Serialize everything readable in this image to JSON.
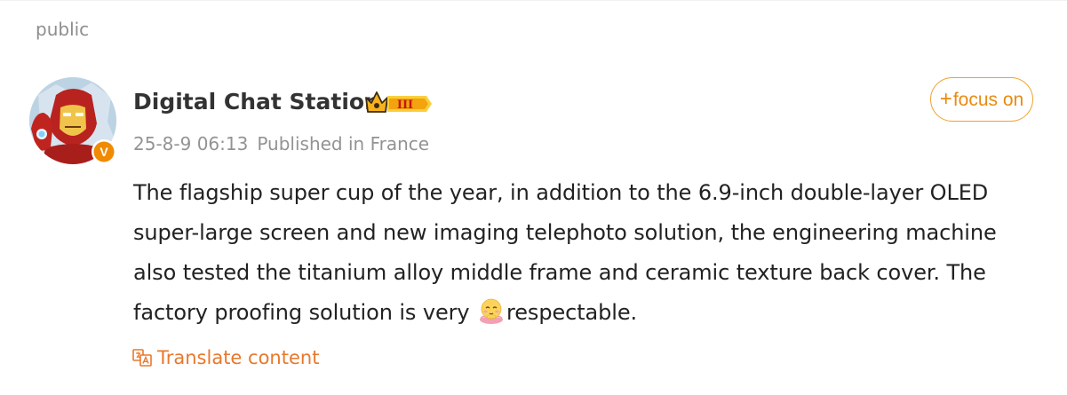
{
  "visibility": "public",
  "author": {
    "name": "Digital Chat Station",
    "rank_badge": "III",
    "verified_badge": "V"
  },
  "post": {
    "date": "25-8-9 06:13",
    "location": "Published in France",
    "text_lines": [
      "The flagship super cup of the year, in addition to the 6.9-inch double-layer OLED",
      "super-large screen and new imaging telephoto solution, the engineering machine",
      "also tested the titanium alloy middle frame and ceramic texture back cover. The",
      "factory proofing solution is very "
    ],
    "text_after_emoji": "respectable.",
    "inline_emoji": "respectful-face-emoji"
  },
  "follow_button": {
    "plus": "+",
    "label": "focus on"
  },
  "translate": {
    "label": "Translate content",
    "icon": "translate-icon"
  },
  "colors": {
    "accent_orange": "#e98b10",
    "translate_orange": "#e9782c",
    "muted_gray": "#939393",
    "text": "#222222",
    "verified_badge": "#f08a00"
  }
}
